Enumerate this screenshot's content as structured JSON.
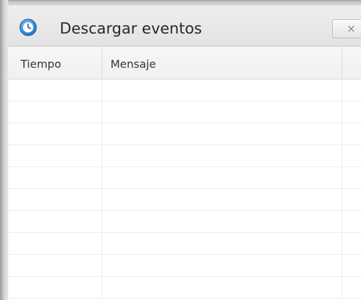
{
  "window": {
    "title": "Descargar eventos",
    "close_label": "×",
    "icon": "clock-icon"
  },
  "table": {
    "columns": [
      "Tiempo",
      "Mensaje",
      ""
    ],
    "rows": [
      [
        "",
        "",
        ""
      ],
      [
        "",
        "",
        ""
      ],
      [
        "",
        "",
        ""
      ],
      [
        "",
        "",
        ""
      ],
      [
        "",
        "",
        ""
      ],
      [
        "",
        "",
        ""
      ],
      [
        "",
        "",
        ""
      ],
      [
        "",
        "",
        ""
      ],
      [
        "",
        "",
        ""
      ],
      [
        "",
        "",
        ""
      ]
    ]
  },
  "colors": {
    "accent": "#2f8fd8",
    "titlebar": "#e6e6e6",
    "grid": "#ececec"
  }
}
